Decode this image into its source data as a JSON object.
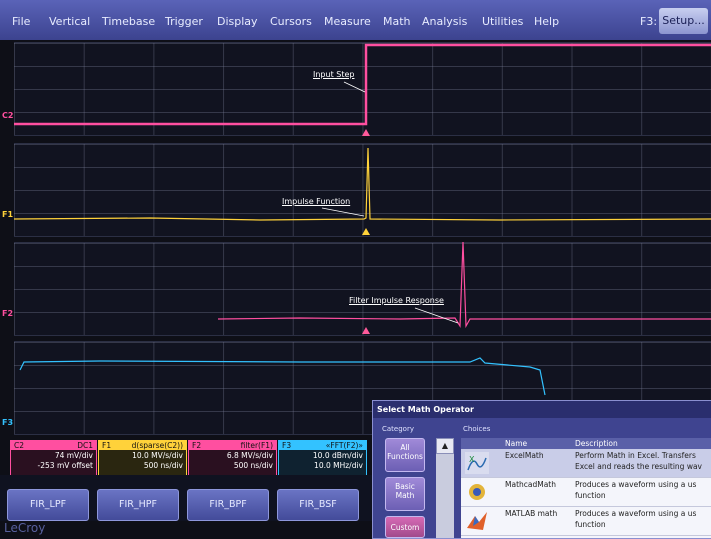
{
  "menu": [
    "File",
    "Vertical",
    "Timebase",
    "Trigger",
    "Display",
    "Cursors",
    "Measure",
    "Math",
    "Analysis",
    "Utilities",
    "Help"
  ],
  "menu_right": {
    "shortcut": "F3:",
    "setup": "Setup..."
  },
  "channels": {
    "c2": "C2",
    "f1": "F1",
    "f2": "F2",
    "f3": "F3"
  },
  "annotations": {
    "input_step": "Input Step",
    "impulse_function": "Impulse Function",
    "filter_impulse_response": "Filter Impulse Response"
  },
  "descriptors": [
    {
      "name": "C2",
      "tag": "DC1",
      "line1": "74 mV/div",
      "line2": "-253 mV offset",
      "color": "#ff4fa0"
    },
    {
      "name": "F1",
      "tag": "d(sparse(C2))",
      "line1": "10.0 MV/s/div",
      "line2": "500 ns/div",
      "color": "#ffd23a"
    },
    {
      "name": "F2",
      "tag": "filter(F1)",
      "line1": "6.8 MV/s/div",
      "line2": "500 ns/div",
      "color": "#ff4fa0"
    },
    {
      "name": "F3",
      "tag": "«FFT(F2)»",
      "line1": "10.0 dBm/div",
      "line2": "10.0 MHz/div",
      "color": "#33c2ff"
    }
  ],
  "softkeys": [
    "FIR_LPF",
    "FIR_HPF",
    "FIR_BPF",
    "FIR_BSF"
  ],
  "brand": "LeCroy",
  "dialog": {
    "title": "Select Math Operator",
    "category_label": "Category",
    "choices_label": "Choices",
    "categories": [
      "All Functions",
      "Basic Math",
      "Custom"
    ],
    "columns": {
      "name": "Name",
      "description": "Description"
    },
    "items": [
      {
        "name": "ExcelMath",
        "line1": "Perform Math in Excel. Transfers",
        "line2": "Excel and reads the resulting wav",
        "icon": "excel-math-icon"
      },
      {
        "name": "MathcadMath",
        "line1": "Produces a waveform using a us",
        "line2": "function",
        "icon": "mathcad-icon"
      },
      {
        "name": "MATLAB math",
        "line1": "Produces a waveform using a us",
        "line2": "function",
        "icon": "matlab-icon"
      }
    ]
  },
  "colors": {
    "c2": "#ff4fa0",
    "f1": "#ffd23a",
    "f2": "#ff4fa0",
    "f3": "#33c2ff",
    "menubar": "#4a52a6"
  }
}
